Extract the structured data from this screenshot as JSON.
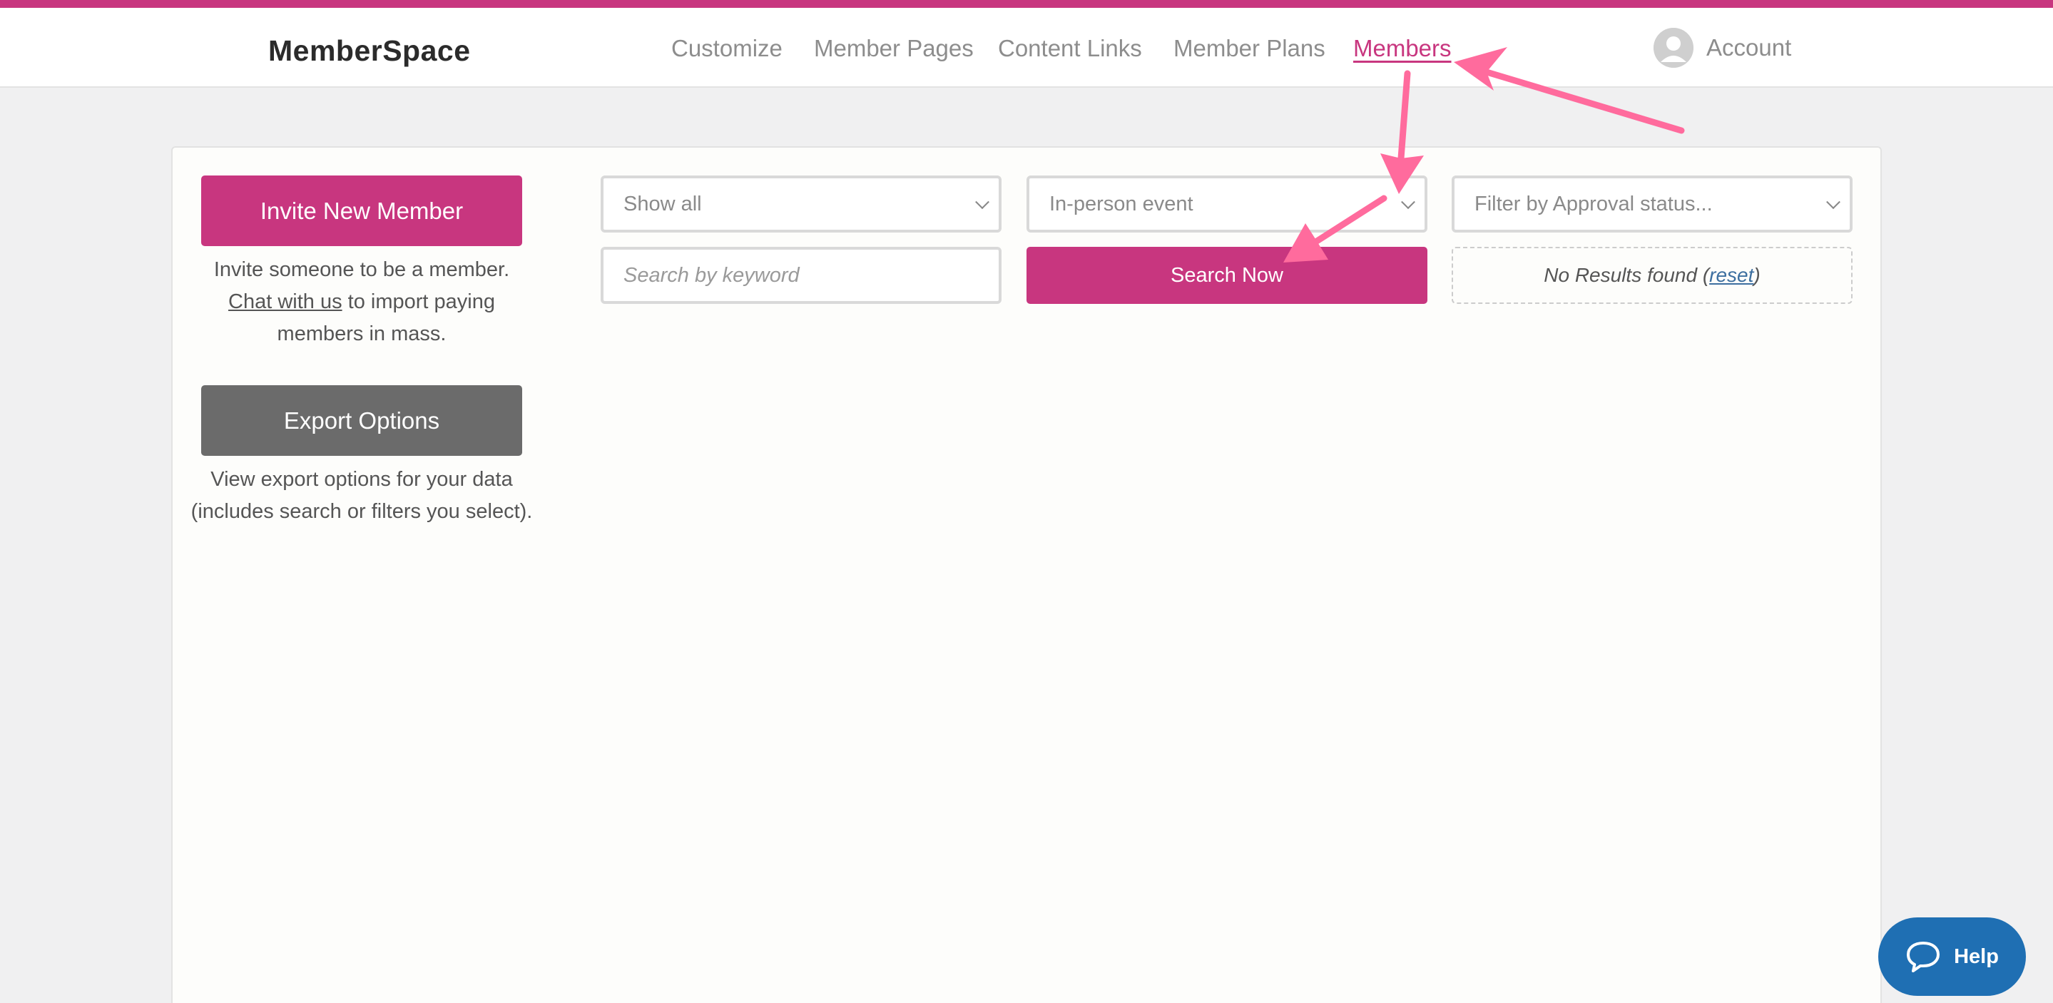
{
  "header": {
    "logo_text": "MemberSpace",
    "nav": [
      {
        "label": "Customize"
      },
      {
        "label": "Member Pages"
      },
      {
        "label": "Content Links"
      },
      {
        "label": "Member Plans"
      },
      {
        "label": "Members"
      }
    ],
    "active_nav": "Members",
    "account_label": "Account"
  },
  "sidebar": {
    "invite_button": "Invite New Member",
    "invite_help_line1": "Invite someone to be a member.",
    "invite_help_link": "Chat with us",
    "invite_help_line2": "to import paying members in mass.",
    "export_button": "Export Options",
    "export_help": "View export options for your data (includes search or filters you select)."
  },
  "filters": {
    "show_select": "Show all",
    "event_select": "In-person event",
    "approval_select": "Filter by Approval status...",
    "search_placeholder": "Search by keyword",
    "search_button": "Search Now",
    "results_text": "No Results found",
    "reset_link": "reset"
  },
  "help_widget": {
    "label": "Help"
  },
  "colors": {
    "brand": "#c8367f",
    "export_button": "#6b6b6b",
    "help_widget": "#1f6fb3",
    "annotation_arrow": "#ff6b9d"
  },
  "icons": [
    "memberspace-logo-icon",
    "avatar-icon",
    "chevron-down-icon",
    "chat-bubble-icon"
  ]
}
